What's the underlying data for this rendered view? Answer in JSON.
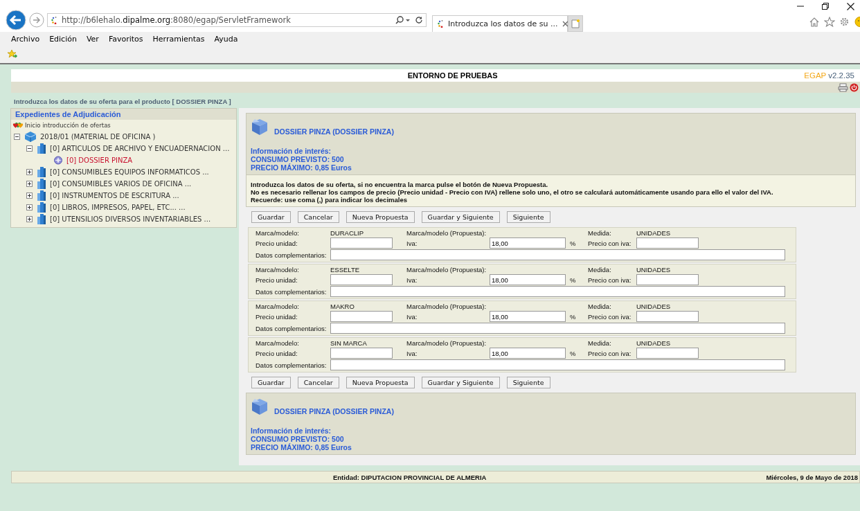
{
  "browser": {
    "url": "http://b6lehalo.**dipalme.org**:8080/egap/ServletFramework",
    "tab_title": "Introduzca los datos de su ...",
    "menu": [
      "Archivo",
      "Edición",
      "Ver",
      "Favoritos",
      "Herramientas",
      "Ayuda"
    ]
  },
  "header": {
    "title": "ENTORNO DE PRUEBAS",
    "brand": "EGAP",
    "version": "v2.2.35"
  },
  "page_title": "Introduzca los datos de su oferta para el producto [ DOSSIER PINZA ]",
  "sidebar": {
    "title": "Expedientes de Adjudicación",
    "start": "Inicio introducción de ofertas",
    "tree": [
      {
        "kind": "project",
        "label": "2018/01 (MATERIAL DE OFICINA )",
        "expanded": true,
        "selected": false,
        "children": [
          {
            "kind": "lot",
            "label": "[0] ARTICULOS DE ARCHIVO Y ENCUADERNACION ...",
            "expanded": true,
            "selected": false,
            "children": [
              {
                "kind": "product",
                "label": "[0] DOSSIER PINZA",
                "selected": true
              }
            ]
          },
          {
            "kind": "lot",
            "label": "[0] CONSUMIBLES EQUIPOS INFORMATICOS ...",
            "expanded": false,
            "selected": false
          },
          {
            "kind": "lot",
            "label": "[0] CONSUMIBLES VARIOS DE OFICINA ...",
            "expanded": false,
            "selected": false
          },
          {
            "kind": "lot",
            "label": "[0] INSTRUMENTOS DE ESCRITURA ...",
            "expanded": false,
            "selected": false
          },
          {
            "kind": "lot",
            "label": "[0] LIBROS, IMPRESOS, PAPEL, ETC... ...",
            "expanded": false,
            "selected": false
          },
          {
            "kind": "lot",
            "label": "[0] UTENSILIOS DIVERSOS INVENTARIABLES ...",
            "expanded": false,
            "selected": false
          }
        ]
      }
    ]
  },
  "info_top": {
    "title": "DOSSIER PINZA (DOSSIER PINZA)",
    "lines": [
      "Información de interés:",
      "CONSUMO PREVISTO: 500",
      "PRECIO MÁXIMO: 0,85 Euros"
    ]
  },
  "instructions": [
    "Introduzca los datos de su oferta, si no encuentra la marca pulse el botón de Nueva Propuesta.",
    "No es necesario rellenar los campos de precio (Precio unidad - Precio con IVA) rellene solo uno, el otro se calculará automáticamente usando para ello el valor del IVA.",
    "Recuerde: use coma (,) para indicar los decimales"
  ],
  "buttons_top": [
    "Guardar",
    "Cancelar",
    "Nueva Propuesta",
    "Guardar y Siguiente",
    "Siguiente"
  ],
  "items": [
    {
      "brand_label": "Marca/modelo:",
      "brand": "DURACLIP",
      "proposal_label": "Marca/modelo (Propuesta):",
      "measure_label": "Medida:",
      "measure": "UNIDADES",
      "unit_price_label": "Precio unidad:",
      "iva_label": "Iva:",
      "iva": "18,00",
      "percent": "%",
      "price_iva_label": "Precio con iva:",
      "extra_label": "Datos complementarios:"
    },
    {
      "brand_label": "Marca/modelo:",
      "brand": "ESSELTE",
      "proposal_label": "Marca/modelo (Propuesta):",
      "measure_label": "Medida:",
      "measure": "UNIDADES",
      "unit_price_label": "Precio unidad:",
      "iva_label": "Iva:",
      "iva": "18,00",
      "percent": "%",
      "price_iva_label": "Precio con iva:",
      "extra_label": "Datos complementarios:"
    },
    {
      "brand_label": "Marca/modelo:",
      "brand": "MAKRO",
      "proposal_label": "Marca/modelo (Propuesta):",
      "measure_label": "Medida:",
      "measure": "UNIDADES",
      "unit_price_label": "Precio unidad:",
      "iva_label": "Iva:",
      "iva": "18,00",
      "percent": "%",
      "price_iva_label": "Precio con iva:",
      "extra_label": "Datos complementarios:"
    },
    {
      "brand_label": "Marca/modelo:",
      "brand": "SIN MARCA",
      "proposal_label": "Marca/modelo (Propuesta):",
      "measure_label": "Medida:",
      "measure": "UNIDADES",
      "unit_price_label": "Precio unidad:",
      "iva_label": "Iva:",
      "iva": "18,00",
      "percent": "%",
      "price_iva_label": "Precio con iva:",
      "extra_label": "Datos complementarios:"
    }
  ],
  "buttons_bottom": [
    "Guardar",
    "Cancelar",
    "Nueva Propuesta",
    "Guardar y Siguiente",
    "Siguiente"
  ],
  "info_bottom": {
    "title": "DOSSIER PINZA (DOSSIER PINZA)",
    "lines": [
      "Información de interés:",
      "CONSUMO PREVISTO: 500",
      "PRECIO MÁXIMO: 0,85 Euros"
    ]
  },
  "footer": {
    "entity": "Entidad: DIPUTACION PROVINCIAL DE ALMERIA",
    "date": "Miércoles, 9 de Mayo de 2018"
  }
}
